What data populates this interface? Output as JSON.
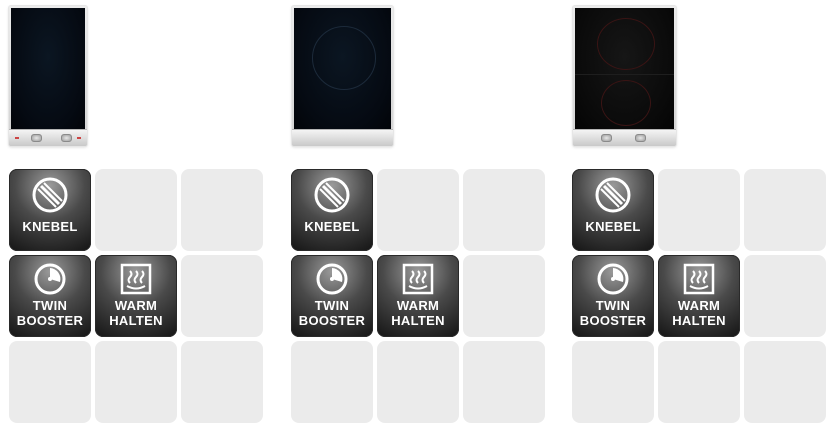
{
  "products": [
    {
      "features": {
        "knob": "KNEBEL",
        "twin_booster": [
          "TWIN",
          "BOOSTER"
        ],
        "keep_warm": [
          "WARM",
          "HALTEN"
        ]
      }
    },
    {
      "features": {
        "knob": "KNEBEL",
        "twin_booster": [
          "TWIN",
          "BOOSTER"
        ],
        "keep_warm": [
          "WARM",
          "HALTEN"
        ]
      }
    },
    {
      "features": {
        "knob": "KNEBEL",
        "twin_booster": [
          "TWIN",
          "BOOSTER"
        ],
        "keep_warm": [
          "WARM",
          "HALTEN"
        ]
      }
    }
  ],
  "icons": {
    "knob": "knob-icon",
    "twin_booster": "timer-gauge-icon",
    "keep_warm": "heat-waves-icon"
  },
  "colors": {
    "tile_empty": "#ebebeb",
    "tile_icon_dark": "#141414",
    "tile_text": "#ffffff"
  }
}
